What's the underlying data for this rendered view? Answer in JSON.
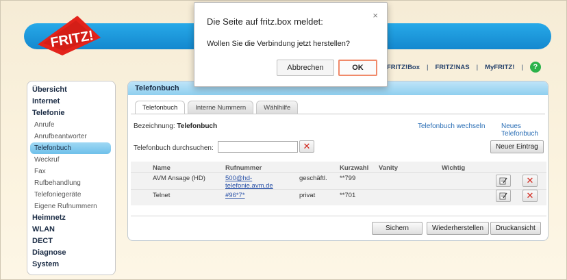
{
  "brand": {
    "logo_text": "FRITZ!"
  },
  "top_nav": {
    "items": [
      "FRITZ!Box",
      "FRITZ!NAS",
      "MyFRITZ!"
    ],
    "help_symbol": "?"
  },
  "sidebar": {
    "items": [
      {
        "label": "Übersicht",
        "level": "main"
      },
      {
        "label": "Internet",
        "level": "main"
      },
      {
        "label": "Telefonie",
        "level": "main"
      },
      {
        "label": "Anrufe",
        "level": "sub"
      },
      {
        "label": "Anrufbeantworter",
        "level": "sub"
      },
      {
        "label": "Telefonbuch",
        "level": "sub",
        "active": true
      },
      {
        "label": "Weckruf",
        "level": "sub"
      },
      {
        "label": "Fax",
        "level": "sub"
      },
      {
        "label": "Rufbehandlung",
        "level": "sub"
      },
      {
        "label": "Telefoniegeräte",
        "level": "sub"
      },
      {
        "label": "Eigene Rufnummern",
        "level": "sub"
      },
      {
        "label": "Heimnetz",
        "level": "main"
      },
      {
        "label": "WLAN",
        "level": "main"
      },
      {
        "label": "DECT",
        "level": "main"
      },
      {
        "label": "Diagnose",
        "level": "main"
      },
      {
        "label": "System",
        "level": "main"
      }
    ]
  },
  "panel": {
    "title": "Telefonbuch",
    "tabs": [
      {
        "label": "Telefonbuch",
        "active": true
      },
      {
        "label": "Interne Nummern"
      },
      {
        "label": "Wählhilfe"
      }
    ],
    "bezeichnung_label": "Bezeichnung:",
    "bezeichnung_value": "Telefonbuch",
    "switch_link": "Telefonbuch wechseln",
    "new_book_link": "Neues Telefonbuch",
    "search_label": "Telefonbuch durchsuchen:",
    "search_value": "",
    "clear_symbol": "✕",
    "new_entry_button": "Neuer Eintrag",
    "table": {
      "headers": [
        "Name",
        "Rufnummer",
        "Kurzwahl",
        "Vanity",
        "Wichtig"
      ],
      "rows": [
        {
          "name": "AVM Ansage (HD)",
          "number_line1": "500@hd-",
          "number_line2": "telefonie.avm.de",
          "type": "geschäftl.",
          "kurzwahl": "**799",
          "vanity": "",
          "wichtig": ""
        },
        {
          "name": "Telnet",
          "number_line1": "#96*7*",
          "number_line2": "",
          "type": "privat",
          "kurzwahl": "**701",
          "vanity": "",
          "wichtig": ""
        }
      ]
    },
    "buttons": {
      "save": "Sichern",
      "restore": "Wiederherstellen",
      "print": "Druckansicht"
    }
  },
  "dialog": {
    "title": "Die Seite auf fritz.box meldet:",
    "message": "Wollen Sie die Verbindung jetzt herstellen?",
    "cancel": "Abbrechen",
    "ok": "OK",
    "close_symbol": "×"
  },
  "colors": {
    "banner": "#1c97dc",
    "active_nav": "#86ccef",
    "delete_red": "#d2261c",
    "help_green": "#2bb24a",
    "ok_border": "#f08a6a"
  }
}
